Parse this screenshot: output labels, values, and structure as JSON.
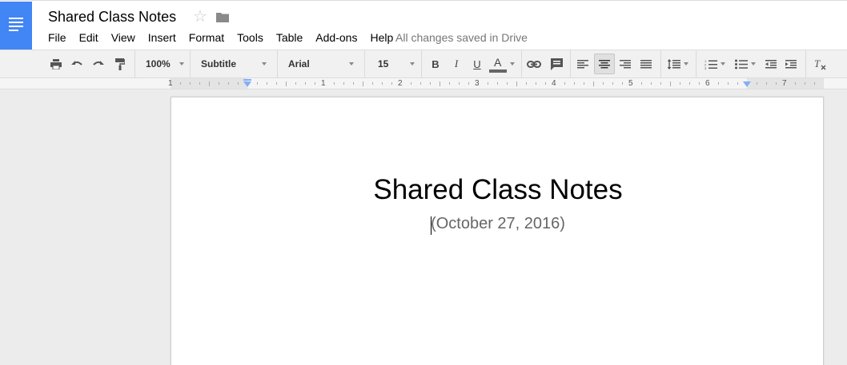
{
  "header": {
    "doc_title": "Shared Class Notes",
    "menu": [
      "File",
      "Edit",
      "View",
      "Insert",
      "Format",
      "Tools",
      "Table",
      "Add-ons",
      "Help"
    ],
    "save_status": "All changes saved in Drive",
    "brand_color": "#4285f4"
  },
  "toolbar": {
    "zoom": "100%",
    "style": "Subtitle",
    "font": "Arial",
    "font_size": "15",
    "bold": "B",
    "italic": "I",
    "underline": "U",
    "text_color": "A",
    "text_color_swatch": "#666666",
    "active_alignment": "center"
  },
  "ruler": {
    "labels": [
      "1",
      "1",
      "2",
      "3",
      "4",
      "5",
      "6",
      "7"
    ]
  },
  "document": {
    "title": "Shared Class Notes",
    "subtitle": "(October 27, 2016)"
  }
}
